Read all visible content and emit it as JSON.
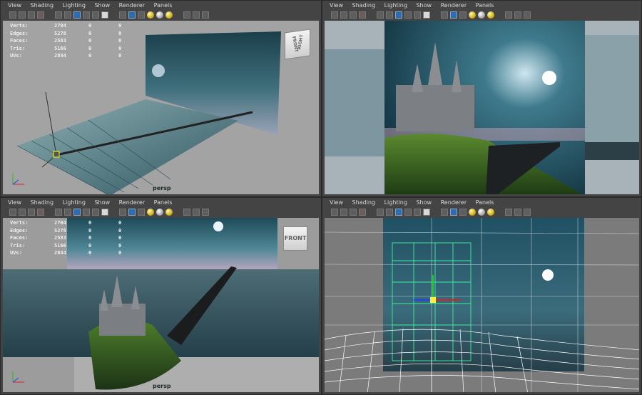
{
  "menus": [
    "View",
    "Shading",
    "Lighting",
    "Show",
    "Renderer",
    "Panels"
  ],
  "hud": {
    "rows": [
      {
        "label": "Verts:",
        "v1": "2704",
        "v2": "0",
        "v3": "0"
      },
      {
        "label": "Edges:",
        "v1": "5278",
        "v2": "0",
        "v3": "0"
      },
      {
        "label": "Faces:",
        "v1": "2583",
        "v2": "0",
        "v3": "0"
      },
      {
        "label": "Tris:",
        "v1": "5166",
        "v2": "0",
        "v3": "0"
      },
      {
        "label": "UVs:",
        "v1": "2844",
        "v2": "0",
        "v3": "0"
      }
    ]
  },
  "viewports": {
    "top_left": {
      "camera": "persp",
      "cube_label_a": "FRONT",
      "cube_label_b": "RIGHT"
    },
    "top_right": {},
    "bottom_left": {
      "camera": "persp",
      "cube_label": "FRONT"
    },
    "bottom_right": {}
  },
  "icons": [
    "select-icon",
    "lasso-icon",
    "paint-icon",
    "camera-icon",
    "grid-icon",
    "film-gate-icon",
    "resolution-gate-icon",
    "safe-action-icon",
    "wireframe-icon",
    "smooth-shade-icon",
    "textured-icon",
    "default-light-icon",
    "all-lights-icon",
    "shadow-icon",
    "isolate-icon",
    "xray-icon",
    "bookmark-icon"
  ],
  "colors": {
    "panel": "#444444",
    "viewport_bg": "#9b9b9b",
    "sky": "#1f4e5c",
    "sea": "#2c4d58",
    "wire": "#ffffff",
    "cage": "#31e08a"
  }
}
